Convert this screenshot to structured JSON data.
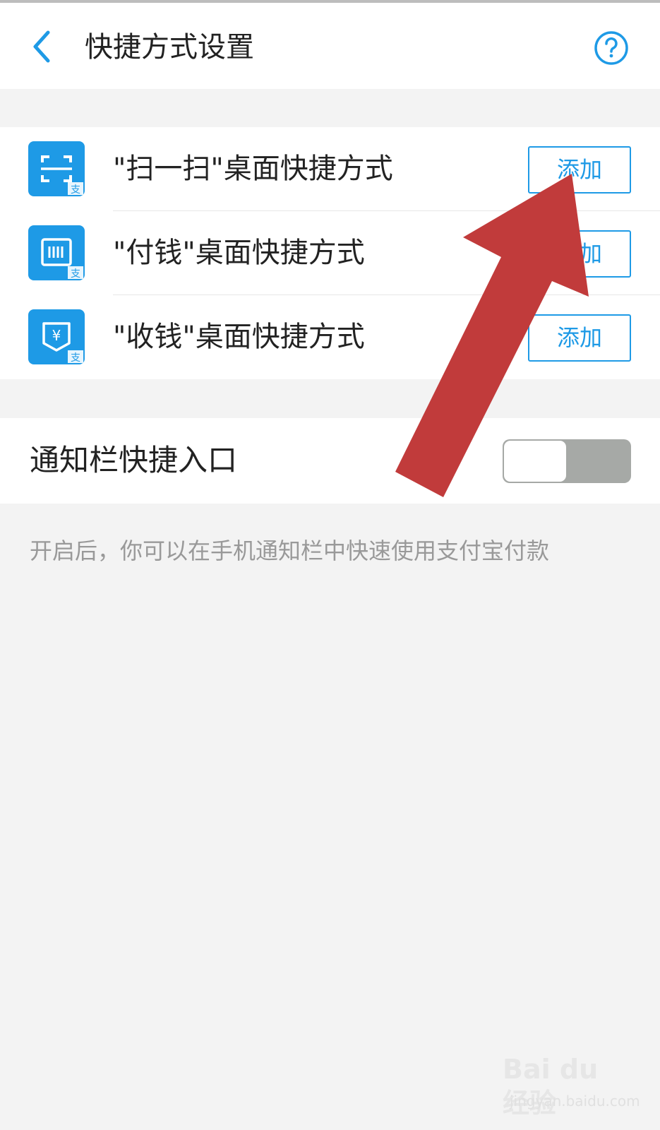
{
  "header": {
    "title": "快捷方式设置",
    "back_icon": "chevron-left-icon",
    "help_icon": "question-circle-icon",
    "accent_color": "#1e9ae6"
  },
  "shortcuts": {
    "items": [
      {
        "label": "\"扫一扫\"桌面快捷方式",
        "button": "添加",
        "icon": "scan-icon"
      },
      {
        "label": "\"付钱\"桌面快捷方式",
        "button": "添加",
        "icon": "barcode-pay-icon"
      },
      {
        "label": "\"收钱\"桌面快捷方式",
        "button": "添加",
        "icon": "yuan-receive-icon"
      }
    ]
  },
  "notification": {
    "label": "通知栏快捷入口",
    "toggle_on": false,
    "hint": "开启后，你可以在手机通知栏中快速使用支付宝付款"
  },
  "overlay": {
    "arrow_color": "#c13b3b"
  },
  "watermark": {
    "logo": "Bai du 经验",
    "url": "jingyan.baidu.com"
  }
}
